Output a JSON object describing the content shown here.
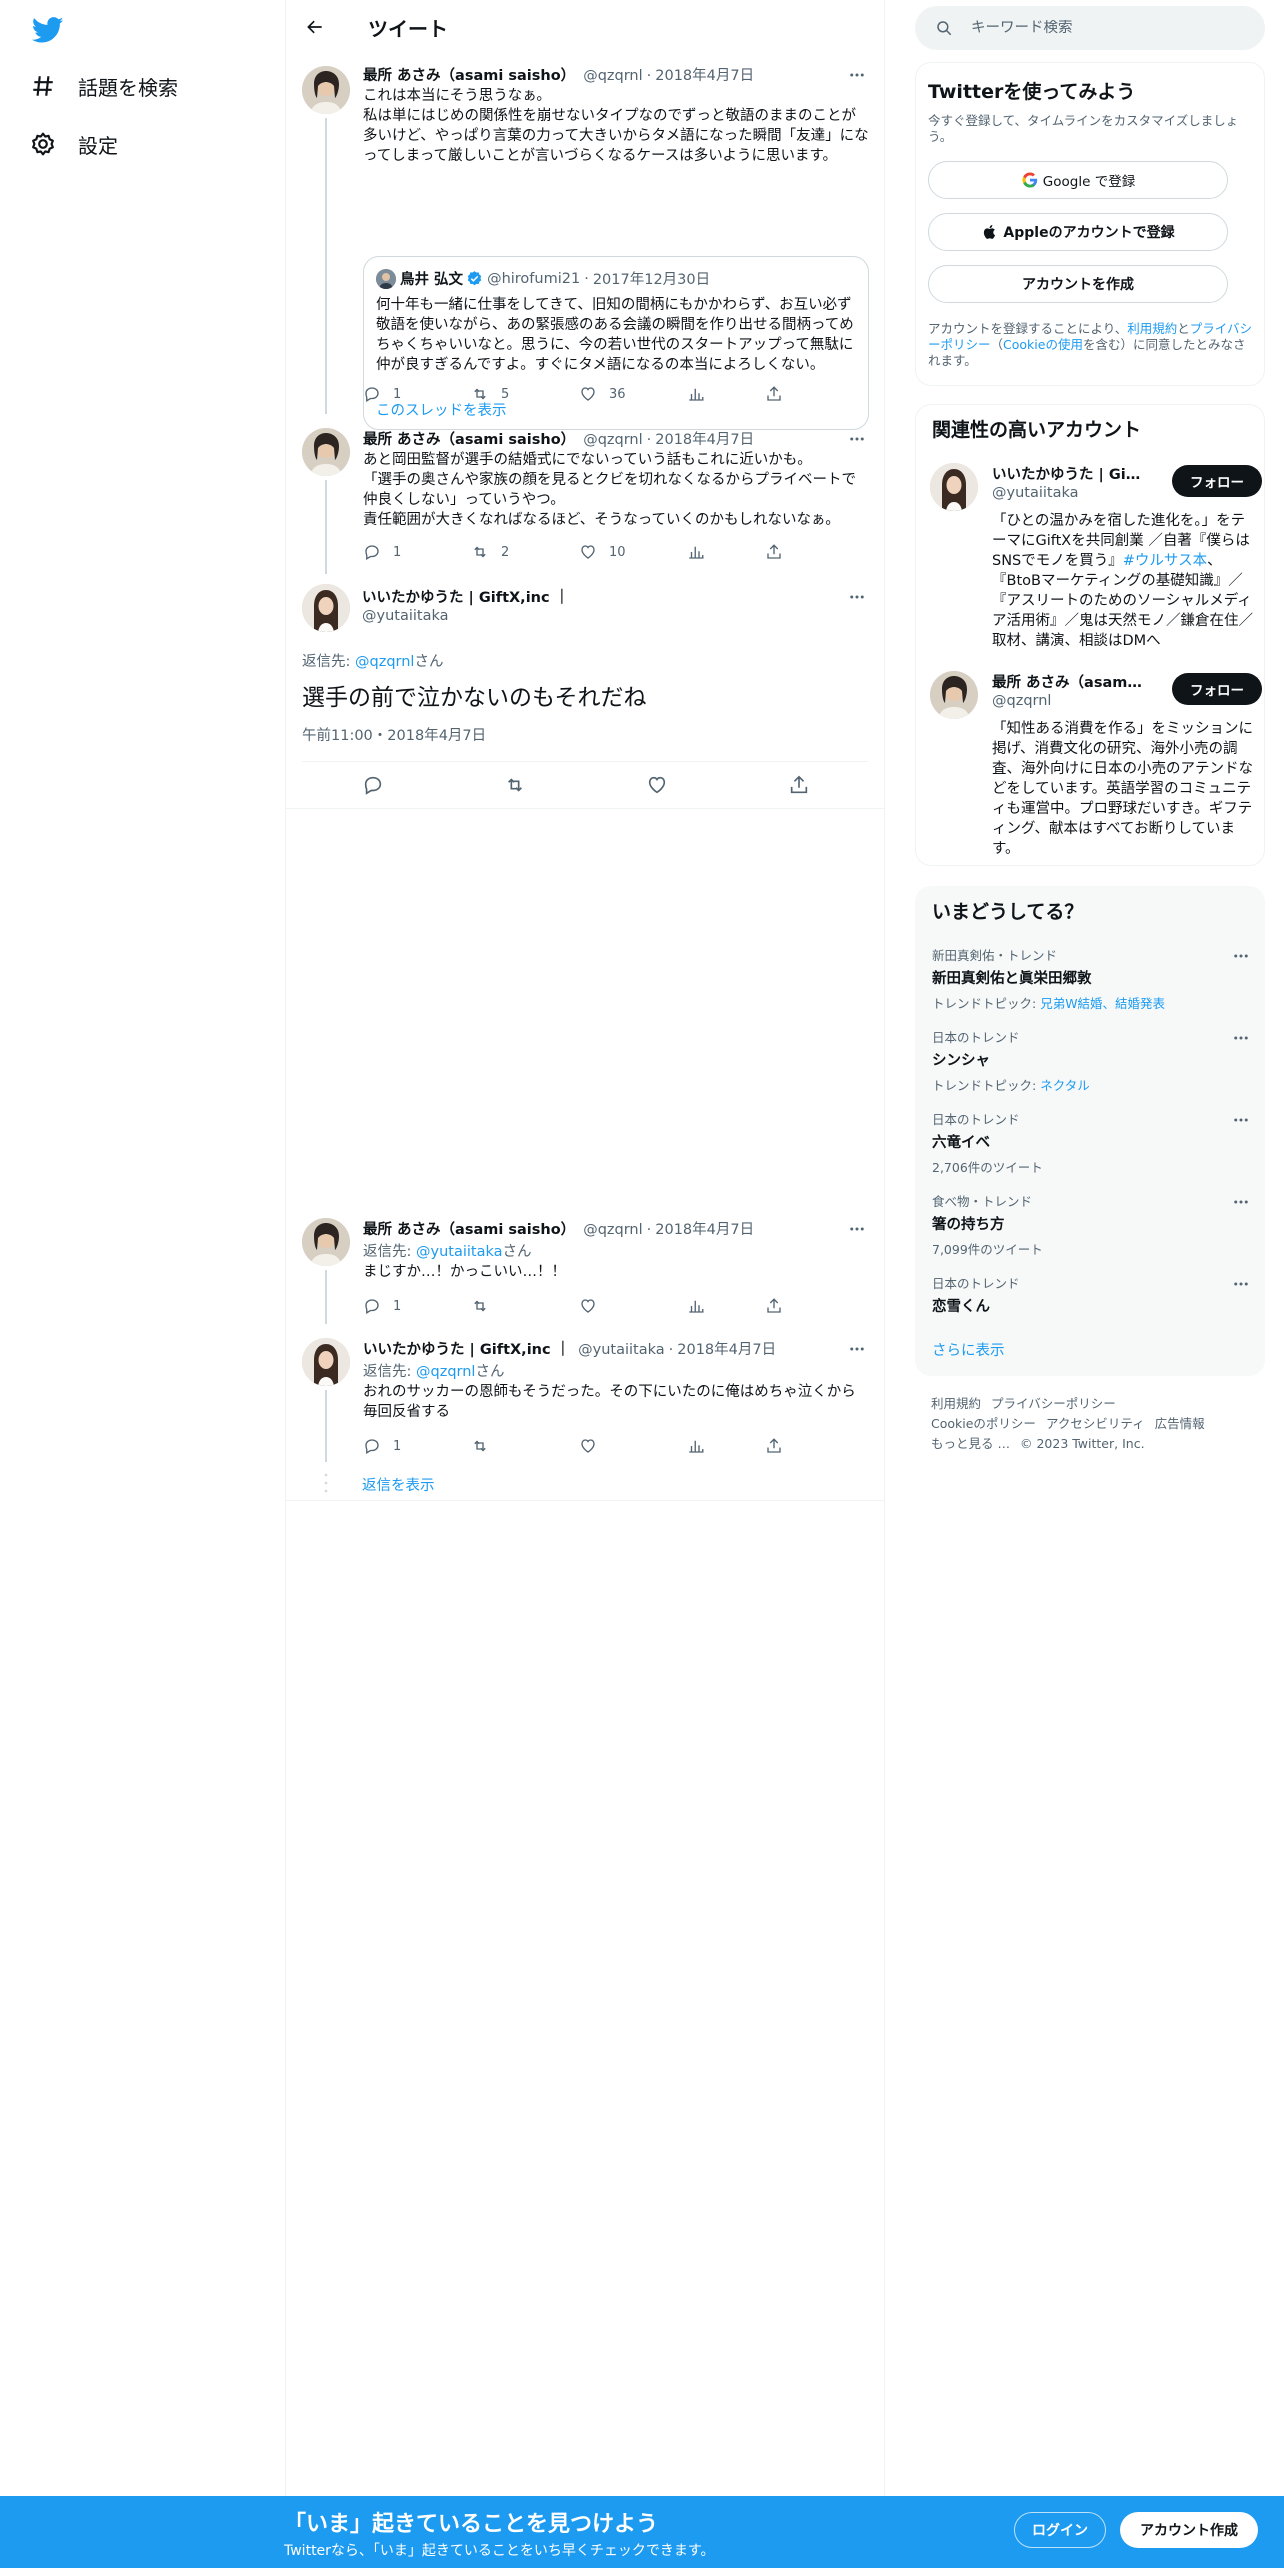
{
  "nav": {
    "explore_label": "話題を検索",
    "settings_label": "設定"
  },
  "header": {
    "title": "ツイート"
  },
  "tweets": [
    {
      "name": "最所 あさみ（asami saisho）",
      "handle": "@qzqrnl",
      "date": "2018年4月7日",
      "text": "これは本当にそう思うなぁ。\n私は単にはじめの関係性を崩せないタイプなのでずっと敬語のままのことが多いけど、やっぱり言葉の力って大きいからタメ語になった瞬間「友達」になってしまって厳しいことが言いづらくなるケースは多いように思います。",
      "replies": "1",
      "retweets": "5",
      "likes": "36",
      "quote": {
        "name": "鳥井 弘文",
        "handle": "@hirofumi21",
        "date": "2017年12月30日",
        "text": "何十年も一緒に仕事をしてきて、旧知の間柄にもかかわらず、お互い必ず敬語を使いながら、あの緊張感のある会議の瞬間を作り出せる間柄ってめちゃくちゃいいなと。思うに、今の若い世代のスタートアップって無駄に仲が良すぎるんですよ。すぐにタメ語になるの本当によろしくない。",
        "link": "このスレッドを表示"
      }
    },
    {
      "name": "最所 あさみ（asami saisho）",
      "handle": "@qzqrnl",
      "date": "2018年4月7日",
      "text": "あと岡田監督が選手の結婚式にでないっていう話もこれに近いかも。\n「選手の奥さんや家族の顔を見るとクビを切れなくなるからプライベートで仲良くしない」っていうやつ。\n責任範囲が大きくなればなるほど、そうなっていくのかもしれないなぁ。",
      "replies": "1",
      "retweets": "2",
      "likes": "10"
    },
    {
      "name": "最所 あさみ（asami saisho）",
      "handle": "@qzqrnl",
      "date": "2018年4月7日",
      "reply_prefix": "返信先: ",
      "reply_user": "@yutaiitaka",
      "reply_suffix": "さん",
      "text": "まじすか…！かっこいい…！！",
      "replies": "1"
    },
    {
      "name": "いいたかゆうた | GiftX,inc ｜",
      "handle": "@yutaiitaka",
      "date": "2018年4月7日",
      "reply_prefix": "返信先: ",
      "reply_user": "@qzqrnl",
      "reply_suffix": "さん",
      "text": "おれのサッカーの恩師もそうだった。その下にいたのに俺はめちゃ泣くから毎回反省する",
      "replies": "1",
      "show_replies": "返信を表示"
    }
  ],
  "focal": {
    "name": "いいたかゆうた | GiftX,inc ｜",
    "handle": "@yutaiitaka",
    "reply_prefix": "返信先: ",
    "reply_user": "@qzqrnl",
    "reply_suffix": "さん",
    "text": "選手の前で泣かないのもそれだね",
    "time": "午前11:00・2018年4月7日"
  },
  "search": {
    "placeholder": "キーワード検索"
  },
  "signup": {
    "title": "Twitterを使ってみよう",
    "subtitle": "今すぐ登録して、タイムラインをカスタマイズしましょう。",
    "google": "Google で登録",
    "apple": "Appleのアカウントで登録",
    "create": "アカウントを作成",
    "terms_prefix": "アカウントを登録することにより、",
    "terms_link1": "利用規約",
    "terms_and": "と",
    "terms_link2": "プライバシーポリシー",
    "terms_mid": "（",
    "terms_link3": "Cookieの使用",
    "terms_suffix": "を含む）に同意したとみなされます。"
  },
  "related": {
    "title": "関連性の高いアカウント",
    "users": [
      {
        "name": "いいたかゆうた | GiftX,inc ｜",
        "handle": "@yutaiitaka",
        "follow": "フォロー",
        "bio_pre": "「ひとの温かみを宿した進化を。」をテーマにGiftXを共同創業 ／自著『僕らはSNSでモノを買う』",
        "bio_tag": "#ウルサス本",
        "bio_post": "、『BtoBマーケティングの基礎知識』／『アスリートのためのソーシャルメディア活用術』／鬼は天然モノ／鎌倉在住／取材、講演、相談はDMへ"
      },
      {
        "name": "最所 あさみ（asami saisho）",
        "handle": "@qzqrnl",
        "follow": "フォロー",
        "bio": "「知性ある消費を作る」をミッションに掲げ、消費文化の研究、海外小売の調査、海外向けに日本の小売のアテンドなどをしています。英語学習のコミュニティも運営中。プロ野球だいすき。ギフティング、献本はすべてお断りしています。"
      }
    ]
  },
  "trends": {
    "title": "いまどうしてる？",
    "items": [
      {
        "meta": "新田真剣佑・トレンド",
        "name": "新田真剣佑と眞栄田郷敦",
        "sub_prefix": "トレンドトピック: ",
        "sub_link": "兄弟W結婚、結婚発表"
      },
      {
        "meta": "日本のトレンド",
        "name": "シンシャ",
        "sub_prefix": "トレンドトピック: ",
        "sub_link": "ネクタル"
      },
      {
        "meta": "日本のトレンド",
        "name": "六竜イベ",
        "sub": "2,706件のツイート"
      },
      {
        "meta": "食べ物・トレンド",
        "name": "箸の持ち方",
        "sub": "7,099件のツイート"
      },
      {
        "meta": "日本のトレンド",
        "name": "恋雪くん"
      }
    ],
    "show_more": "さらに表示"
  },
  "footer": {
    "links": [
      "利用規約",
      "プライバシーポリシー",
      "Cookieのポリシー",
      "アクセシビリティ",
      "広告情報",
      "もっと見る …"
    ],
    "copyright": "© 2023 Twitter, Inc."
  },
  "bottombar": {
    "title": "「いま」起きていることを見つけよう",
    "subtitle": "Twitterなら、「いま」起きていることをいち早くチェックできます。",
    "login": "ログイン",
    "signup": "アカウント作成"
  },
  "colors": {
    "accent": "#1d9bf0",
    "text": "#0f1419",
    "muted": "#536471",
    "border": "#eff3f4"
  }
}
